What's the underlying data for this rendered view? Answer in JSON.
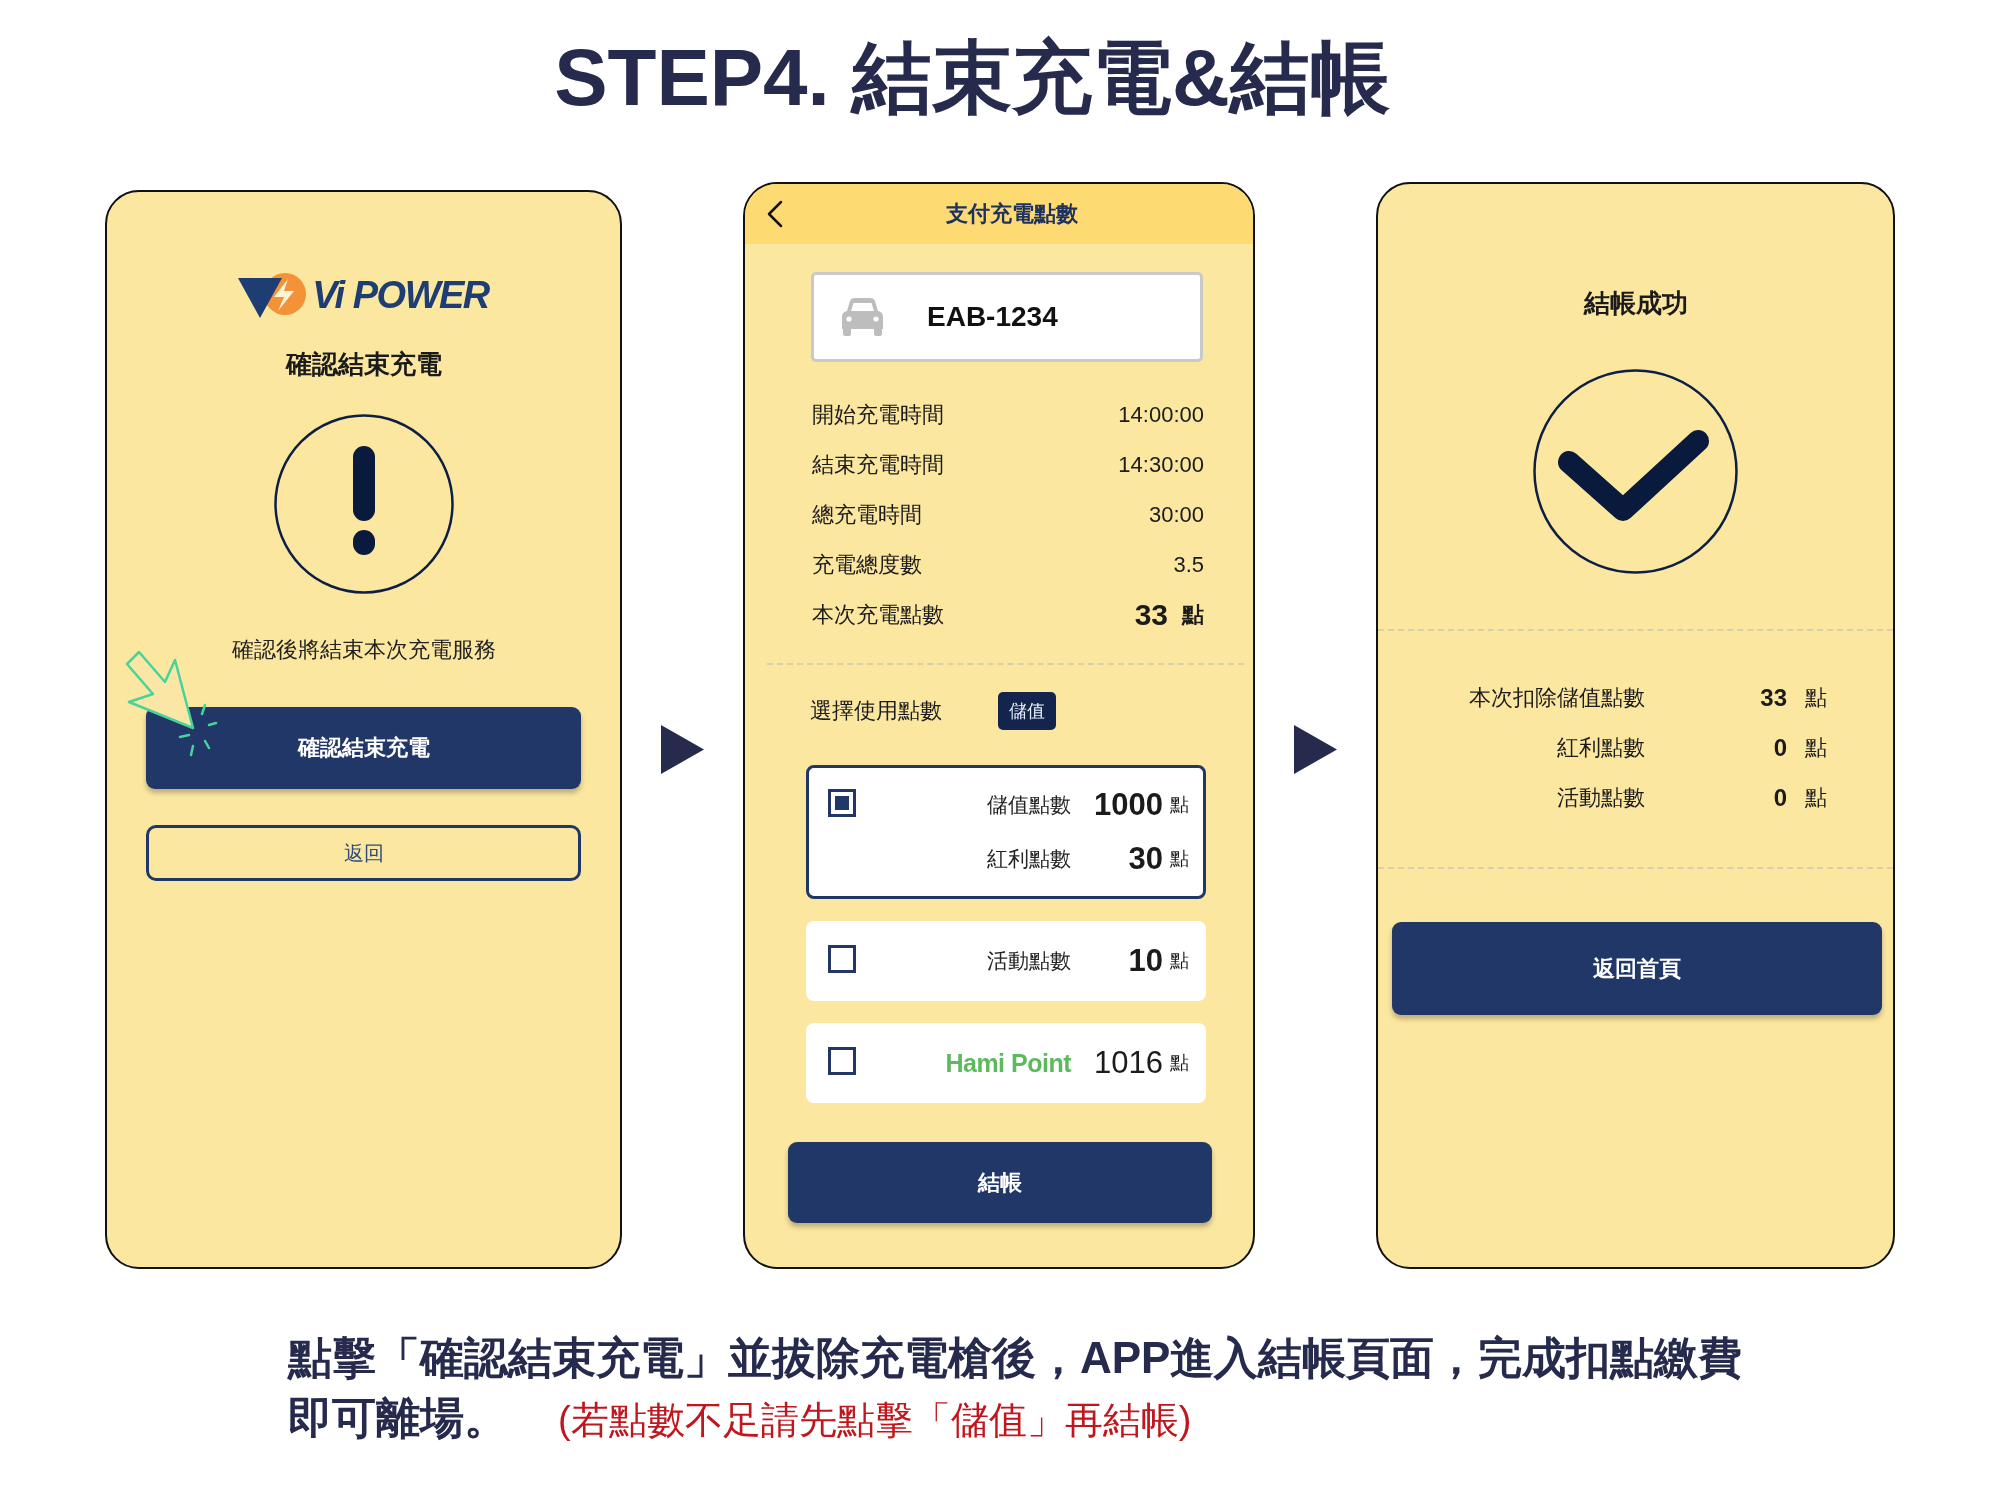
{
  "title": "STEP4. 結束充電&結帳",
  "screens": [
    {
      "kind": "confirm",
      "logo": {
        "text": "Vi POWER"
      },
      "heading": "確認結束充電",
      "message": "確認後將結束本次充電服務",
      "primary_button": "確認結束充電",
      "secondary_button": "返回"
    },
    {
      "kind": "payment",
      "header": {
        "title": "支付充電點數"
      },
      "plate": "EAB-1234",
      "details": [
        {
          "kind": "plain",
          "label": "開始充電時間",
          "value": "14:00:00"
        },
        {
          "kind": "plain",
          "label": "結束充電時間",
          "value": "14:30:00"
        },
        {
          "kind": "plain",
          "label": "總充電時間",
          "value": "30:00"
        },
        {
          "kind": "plain",
          "label": "充電總度數",
          "value": "3.5"
        },
        {
          "kind": "total",
          "label": "本次充電點數",
          "value": "33",
          "unit": "點"
        }
      ],
      "points": {
        "label": "選擇使用點數",
        "top_up_button": "儲值",
        "options": [
          {
            "checked": true,
            "lines": [
              {
                "kind": "text",
                "label": "儲值點數",
                "value": "1000",
                "unit": "點"
              },
              {
                "kind": "text",
                "label": "紅利點數",
                "value": "30",
                "unit": "點"
              }
            ]
          },
          {
            "checked": false,
            "lines": [
              {
                "kind": "text",
                "label": "活動點數",
                "value": "10",
                "unit": "點"
              }
            ]
          },
          {
            "checked": false,
            "lines": [
              {
                "kind": "brand",
                "label": "Hami Point",
                "value": "1016",
                "unit": "點"
              }
            ]
          }
        ]
      },
      "button": "結帳"
    },
    {
      "kind": "success",
      "heading": "結帳成功",
      "summary": [
        {
          "label": "本次扣除儲值點數",
          "value": "33",
          "unit": "點"
        },
        {
          "label": "紅利點數",
          "value": "0",
          "unit": "點"
        },
        {
          "label": "活動點數",
          "value": "0",
          "unit": "點"
        }
      ],
      "button": "返回首頁"
    }
  ],
  "caption": {
    "lines": [
      "點擊「確認結束充電」並拔除充電槍後，APP進入結帳頁面，完成扣點繳費",
      "即可離場。"
    ],
    "note": "(若點數不足請先點擊「儲值」再結帳)"
  }
}
